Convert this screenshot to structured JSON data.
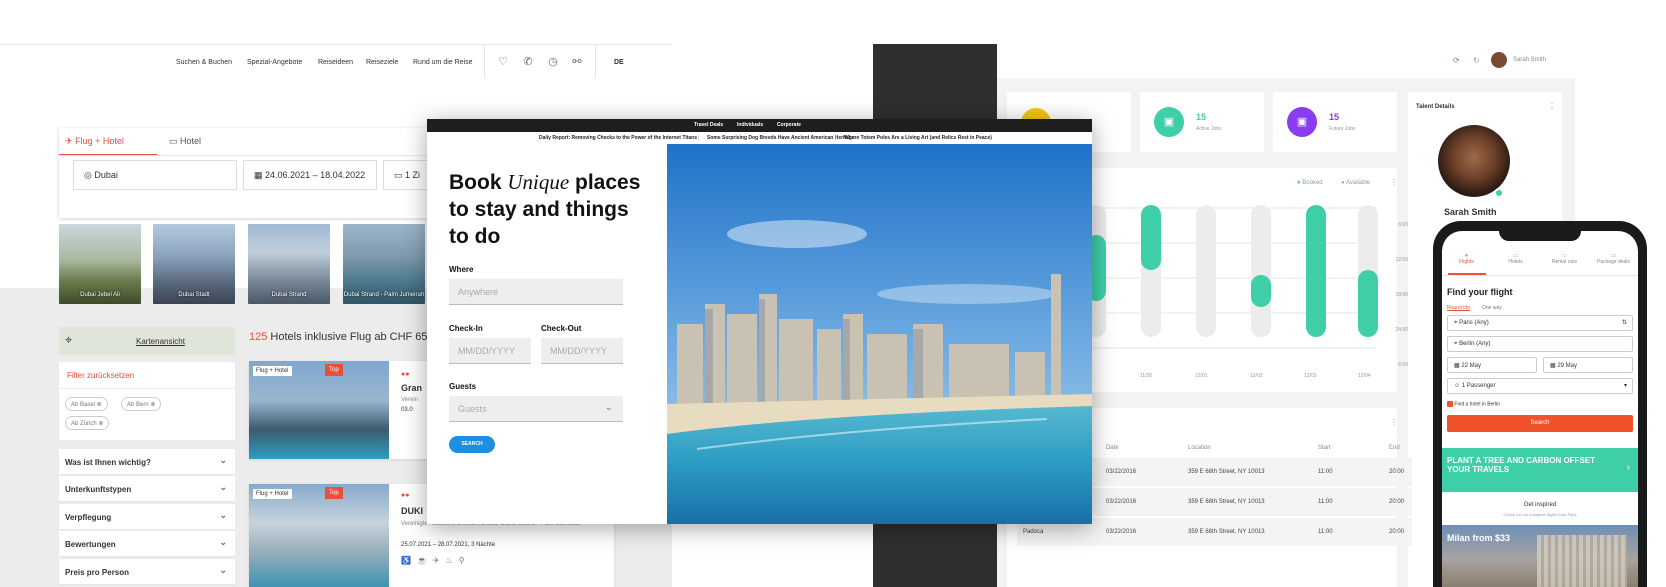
{
  "left_site": {
    "nav": {
      "links": [
        "Suchen & Buchen",
        "Spezial-Angebote",
        "Reiseideen",
        "Reiseziele",
        "Rund um die Reise"
      ],
      "lang": "DE"
    },
    "search": {
      "tab_flight_hotel": "Flug + Hotel",
      "tab_hotel": "Hotel",
      "destination": "Dubai",
      "dates": "24.06.2021 – 18.04.2022",
      "guests": "1 Zi"
    },
    "destinations": [
      "Dubai Jebel Ali",
      "Dubai Stadt",
      "Dubai Strand",
      "Dubai Strand - Palm Jumeirah"
    ],
    "map_view": "Kartenansicht",
    "results": {
      "count": "125",
      "text": "Hotels inklusive Flug ab CHF 65"
    },
    "filters": {
      "reset": "Filter zurücksetzen",
      "chips": [
        "Ab Basel",
        "Ab Bern",
        "Ab Zürich"
      ],
      "sections": [
        "Was ist Ihnen wichtig?",
        "Unterkunftstypen",
        "Verpflegung",
        "Bewertungen",
        "Preis pro Person"
      ]
    },
    "hotels": [
      {
        "badge": "Flug + Hotel",
        "top": "Top",
        "name": "Gran",
        "region": "Verein",
        "dates": "03.0"
      },
      {
        "badge": "Flug + Hotel",
        "top": "Top",
        "name": "DUKI",
        "region": "Vereinigte Arabische Emirate, Dubai, Dubai Strand - Palm Jumeirah",
        "dates": "25.07.2021 – 28.07.2021, 3 Nächte"
      }
    ]
  },
  "center_site": {
    "top_nav": [
      "Travel Deals",
      "Individuals",
      "Corporate"
    ],
    "ticker": [
      "Daily Report: Removing Checks to the Power of the Internet Titans",
      "Some Surprising Dog Breeds Have Ancient American Heritage",
      "Where Totem Poles Are a Living Art (and Relics Rest in Peace)"
    ],
    "headline_1": "Book",
    "headline_italic": "Unique",
    "headline_2": "places",
    "headline_3": "to stay and things",
    "headline_4": "to do",
    "where_label": "Where",
    "where_placeholder": "Anywhere",
    "checkin_label": "Check-In",
    "checkout_label": "Check-Out",
    "date_placeholder": "MM/DD/YYYY",
    "guests_label": "Guests",
    "guests_placeholder": "Guests",
    "search_button": "SEARCH"
  },
  "dashboard": {
    "user": "Sarah Smith",
    "stats": [
      {
        "value": "15",
        "label": "Active Jobs",
        "color": "#3ecfa8"
      },
      {
        "value": "15",
        "label": "Future Jobs",
        "color": "#8a3cf0"
      }
    ],
    "legend": {
      "booked": "Booked",
      "available": "Available"
    },
    "chart_ticks": [
      "6:00",
      "12:00",
      "18:00",
      "24:00",
      "6:00"
    ],
    "chart_dates": [
      "11/30",
      "12/01",
      "12/02",
      "12/03",
      "12/04"
    ],
    "talent_title": "Talent Details",
    "talent_name": "Sarah Smith",
    "table_headers": [
      "Date",
      "Location",
      "Start",
      "End"
    ],
    "table_rows": [
      {
        "name": "",
        "date": "03/22/2016",
        "location": "359 E 68th Street, NY 10013",
        "start": "11:00",
        "end": "20:00"
      },
      {
        "name": "",
        "date": "03/22/2016",
        "location": "359 E 68th Street, NY 10013",
        "start": "11:00",
        "end": "20:00"
      },
      {
        "name": "Padoca",
        "date": "03/22/2016",
        "location": "359 E 68th Street, NY 10013",
        "start": "11:00",
        "end": "20:00"
      }
    ]
  },
  "phone_app": {
    "tabs": [
      "Flights",
      "Hotels",
      "Rental cars",
      "Package deals"
    ],
    "title": "Find your flight",
    "trip_round": "Round trip",
    "trip_oneway": "One way",
    "from": "Paris (Any)",
    "to": "Berlin (Any)",
    "date_out": "22 May",
    "date_back": "29 May",
    "passengers": "1 Passenger",
    "hotel_check": "Find a hotel in Berlin",
    "search_button": "Search",
    "banner": "PLANT A TREE AND CARBON OFFSET YOUR TRAVELS",
    "inspired_title": "Get inspired",
    "inspired_sub": "Check out our cheapest flights from Paris",
    "promo": "Milan from $33",
    "accent": "#f0532c"
  }
}
